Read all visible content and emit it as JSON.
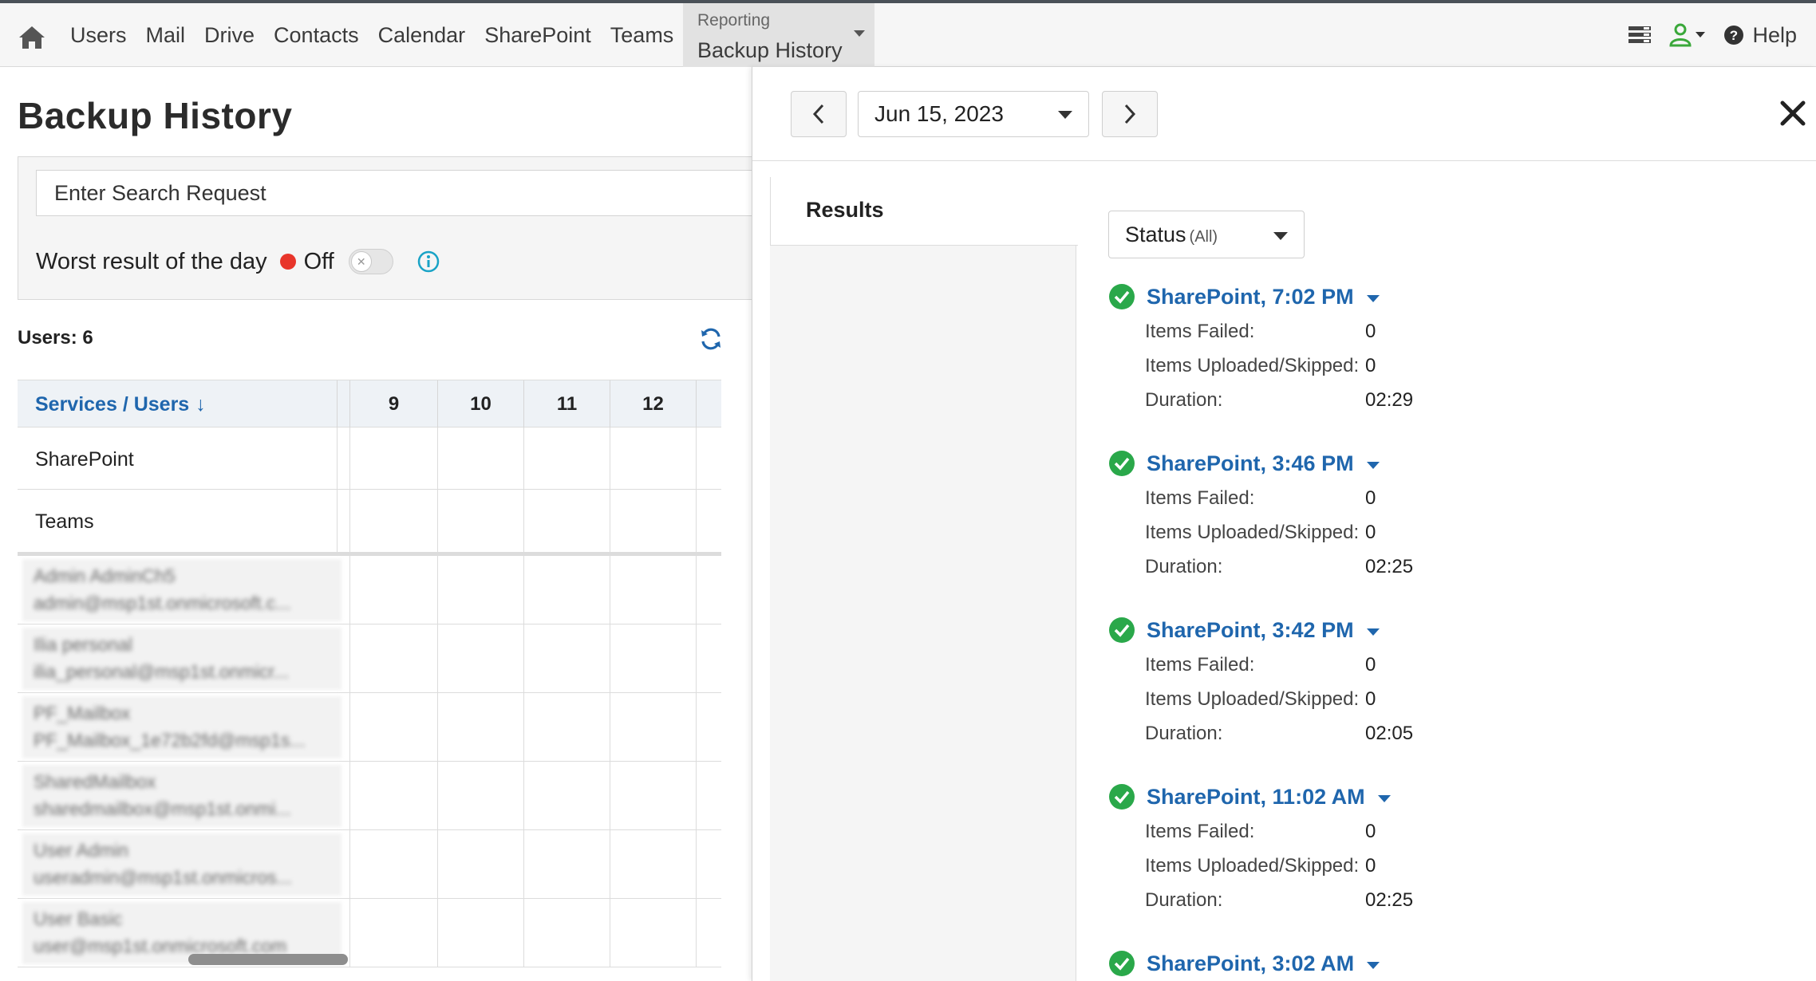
{
  "nav": {
    "items": [
      "Users",
      "Mail",
      "Drive",
      "Contacts",
      "Calendar",
      "SharePoint",
      "Teams"
    ],
    "dropdown_small": "Reporting",
    "dropdown_label": "Backup History",
    "help_label": "Help",
    "icons": {
      "home": "home-icon",
      "tasks": "tasks-icon",
      "user": "user-icon",
      "help": "help-icon"
    },
    "user_icon_color": "#3aa83a"
  },
  "left": {
    "title": "Backup History",
    "search_placeholder": "Enter Search Request",
    "worst_label": "Worst result of the day",
    "worst_state": "Off",
    "users_count": "Users: 6",
    "grid": {
      "services_header": "Services / Users",
      "sort_arrow": "↓",
      "columns": [
        "9",
        "10",
        "11",
        "12"
      ],
      "service_rows": [
        "SharePoint",
        "Teams"
      ],
      "users": [
        {
          "name": "Admin AdminCh5",
          "email": "admin@msp1st.onmicrosoft.c..."
        },
        {
          "name": "Ilia personal",
          "email": "ilia_personal@msp1st.onmicr..."
        },
        {
          "name": "PF_Mailbox",
          "email": "PF_Mailbox_1e72b2fd@msp1s..."
        },
        {
          "name": "SharedMailbox",
          "email": "sharedmailbox@msp1st.onmi..."
        },
        {
          "name": "User Admin",
          "email": "useradmin@msp1st.onmicros..."
        },
        {
          "name": "User Basic",
          "email": "user@msp1st.onmicrosoft.com"
        }
      ]
    }
  },
  "drawer": {
    "date": "Jun 15, 2023",
    "tab_label": "Results",
    "status_label": "Status",
    "status_value": "(All)",
    "field_labels": {
      "failed": "Items Failed:",
      "uploaded": "Items Uploaded/Skipped:",
      "duration": "Duration:"
    },
    "entries": [
      {
        "title": "SharePoint, 7:02 PM",
        "failed": "0",
        "uploaded": "0",
        "duration": "02:29"
      },
      {
        "title": "SharePoint, 3:46 PM",
        "failed": "0",
        "uploaded": "0",
        "duration": "02:25"
      },
      {
        "title": "SharePoint, 3:42 PM",
        "failed": "0",
        "uploaded": "0",
        "duration": "02:05"
      },
      {
        "title": "SharePoint, 11:02 AM",
        "failed": "0",
        "uploaded": "0",
        "duration": "02:25"
      },
      {
        "title": "SharePoint, 3:02 AM",
        "failed": "",
        "uploaded": "",
        "duration": ""
      }
    ],
    "success_color": "#2aa84a",
    "link_color": "#1f66ad"
  }
}
